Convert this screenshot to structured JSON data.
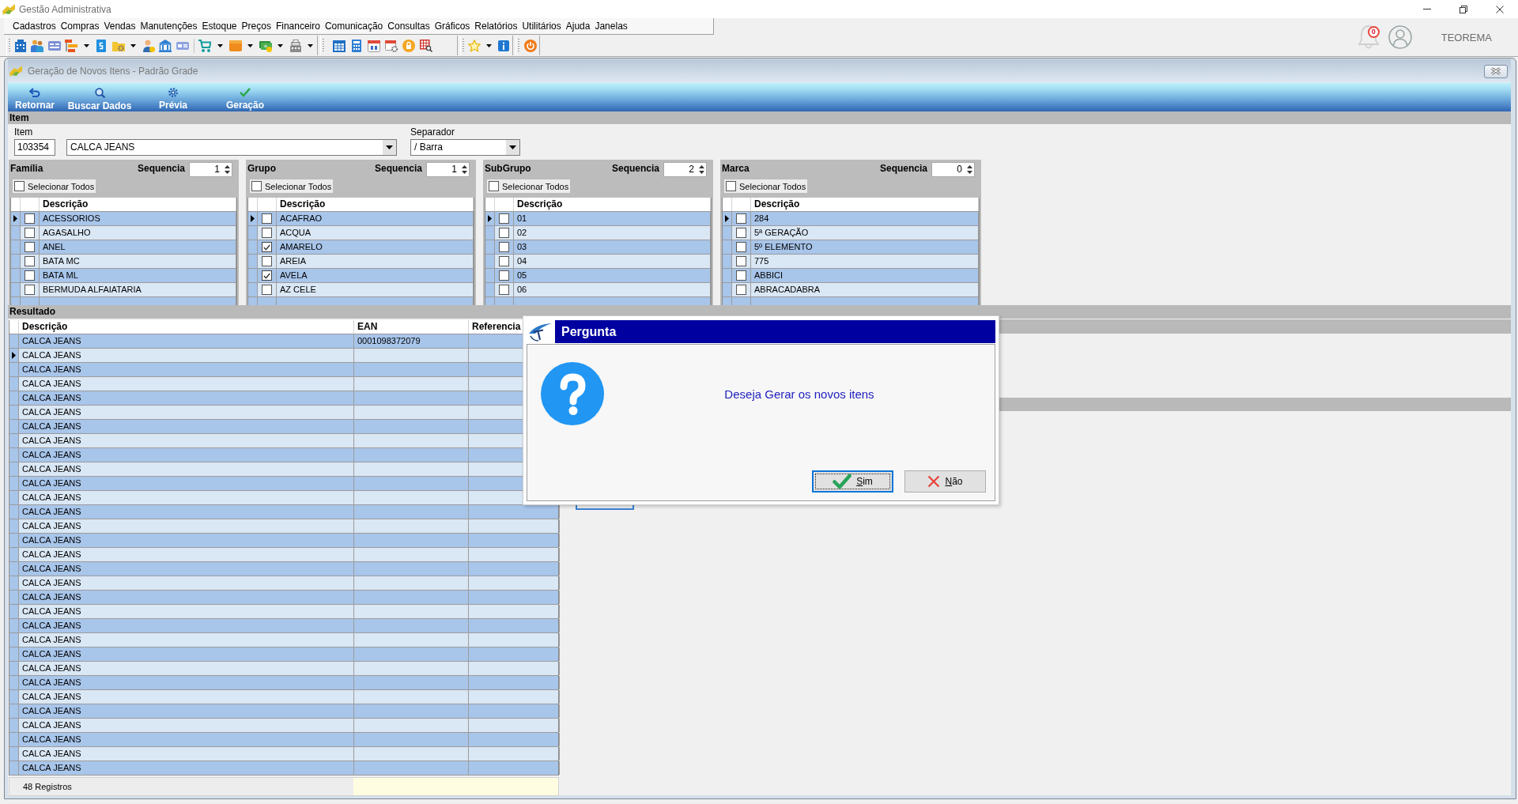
{
  "window": {
    "title": "Gestão Administrativa"
  },
  "menu": [
    "Cadastros",
    "Compras",
    "Vendas",
    "Manutenções",
    "Estoque",
    "Preços",
    "Financeiro",
    "Comunicação",
    "Consultas",
    "Gráficos",
    "Relatórios",
    "Utilitários",
    "Ajuda",
    "Janelas"
  ],
  "notifications": {
    "count": "0"
  },
  "user": {
    "name": "TEOREMA"
  },
  "form": {
    "title": "Geração de Novos Itens - Padrão Grade",
    "toolbar": [
      "Retornar",
      "Buscar Dados",
      "Prévia",
      "Geração"
    ],
    "item": {
      "section": "Item",
      "code_label": "Item",
      "code": "103354",
      "description": "CALCA JEANS",
      "separator_label": "Separador",
      "separator": "/ Barra"
    },
    "panels": [
      {
        "title": "Família",
        "sequence_label": "Sequencia",
        "sequence": "1",
        "select_all": {
          "label": "Selecionar Todos",
          "checked": false
        },
        "column": "Descrição",
        "rows": [
          {
            "text": "ACESSORIOS",
            "checked": false,
            "selected": true
          },
          {
            "text": "AGASALHO",
            "checked": false,
            "selected": false
          },
          {
            "text": "ANEL",
            "checked": false,
            "selected": false
          },
          {
            "text": "BATA MC",
            "checked": false,
            "selected": false
          },
          {
            "text": "BATA ML",
            "checked": false,
            "selected": false
          },
          {
            "text": "BERMUDA ALFAIATARIA",
            "checked": false,
            "selected": false
          }
        ]
      },
      {
        "title": "Grupo",
        "sequence_label": "Sequencia",
        "sequence": "1",
        "select_all": {
          "label": "Selecionar Todos",
          "checked": false
        },
        "column": "Descrição",
        "rows": [
          {
            "text": "ACAFRAO",
            "checked": false,
            "selected": true
          },
          {
            "text": "ACQUA",
            "checked": false,
            "selected": false
          },
          {
            "text": "AMARELO",
            "checked": true,
            "selected": false
          },
          {
            "text": "AREIA",
            "checked": false,
            "selected": false
          },
          {
            "text": "AVELA",
            "checked": true,
            "selected": false
          },
          {
            "text": "AZ CELE",
            "checked": false,
            "selected": false
          }
        ]
      },
      {
        "title": "SubGrupo",
        "sequence_label": "Sequencia",
        "sequence": "2",
        "select_all": {
          "label": "Selecionar Todos",
          "checked": false
        },
        "column": "Descrição",
        "rows": [
          {
            "text": "01",
            "checked": false,
            "selected": true
          },
          {
            "text": "02",
            "checked": false,
            "selected": false
          },
          {
            "text": "03",
            "checked": false,
            "selected": false
          },
          {
            "text": "04",
            "checked": false,
            "selected": false
          },
          {
            "text": "05",
            "checked": false,
            "selected": false
          },
          {
            "text": "06",
            "checked": false,
            "selected": false
          }
        ]
      },
      {
        "title": "Marca",
        "sequence_label": "Sequencia",
        "sequence": "0",
        "select_all": {
          "label": "Selecionar Todos",
          "checked": false
        },
        "column": "Descrição",
        "rows": [
          {
            "text": "284",
            "checked": false,
            "selected": true
          },
          {
            "text": "5ª GERAÇÃO",
            "checked": false,
            "selected": false
          },
          {
            "text": "5º ELEMENTO",
            "checked": false,
            "selected": false
          },
          {
            "text": "775",
            "checked": false,
            "selected": false
          },
          {
            "text": "ABBICI",
            "checked": false,
            "selected": false
          },
          {
            "text": "ABRACADABRA",
            "checked": false,
            "selected": false
          }
        ]
      }
    ],
    "result": {
      "section": "Resultado",
      "columns": [
        "Descrição",
        "EAN",
        "Referencia"
      ],
      "rows": [
        {
          "description": "CALCA JEANS",
          "ean": "0001098372079",
          "selected": false
        },
        {
          "description": "CALCA JEANS",
          "selected": true
        },
        {
          "description": "CALCA JEANS",
          "selected": false
        },
        {
          "description": "CALCA JEANS",
          "selected": false
        },
        {
          "description": "CALCA JEANS",
          "selected": false
        },
        {
          "description": "CALCA JEANS",
          "selected": false
        },
        {
          "description": "CALCA JEANS",
          "selected": false
        },
        {
          "description": "CALCA JEANS",
          "selected": false
        },
        {
          "description": "CALCA JEANS",
          "selected": false
        },
        {
          "description": "CALCA JEANS",
          "selected": false
        },
        {
          "description": "CALCA JEANS",
          "selected": false
        },
        {
          "description": "CALCA JEANS",
          "selected": false
        },
        {
          "description": "CALCA JEANS",
          "selected": false
        },
        {
          "description": "CALCA JEANS",
          "selected": false
        },
        {
          "description": "CALCA JEANS",
          "selected": false
        },
        {
          "description": "CALCA JEANS",
          "selected": false
        },
        {
          "description": "CALCA JEANS",
          "selected": false
        },
        {
          "description": "CALCA JEANS",
          "selected": false
        },
        {
          "description": "CALCA JEANS",
          "selected": false
        },
        {
          "description": "CALCA JEANS",
          "selected": false
        },
        {
          "description": "CALCA JEANS",
          "selected": false
        },
        {
          "description": "CALCA JEANS",
          "selected": false
        },
        {
          "description": "CALCA JEANS",
          "selected": false
        },
        {
          "description": "CALCA JEANS",
          "selected": false
        },
        {
          "description": "CALCA JEANS",
          "selected": false
        },
        {
          "description": "CALCA JEANS",
          "selected": false
        },
        {
          "description": "CALCA JEANS",
          "selected": false
        },
        {
          "description": "CALCA JEANS",
          "selected": false
        },
        {
          "description": "CALCA JEANS",
          "selected": false
        },
        {
          "description": "CALCA JEANS",
          "selected": false
        },
        {
          "description": "CALCA JEANS",
          "selected": false
        }
      ],
      "footer": "48 Registros"
    }
  },
  "dialog": {
    "title": "Pergunta",
    "message": "Deseja Gerar os novos itens",
    "buttons": [
      {
        "label": "Sim",
        "kind": "confirm",
        "focused": true
      },
      {
        "label": "Não",
        "kind": "cancel",
        "focused": false
      }
    ]
  }
}
